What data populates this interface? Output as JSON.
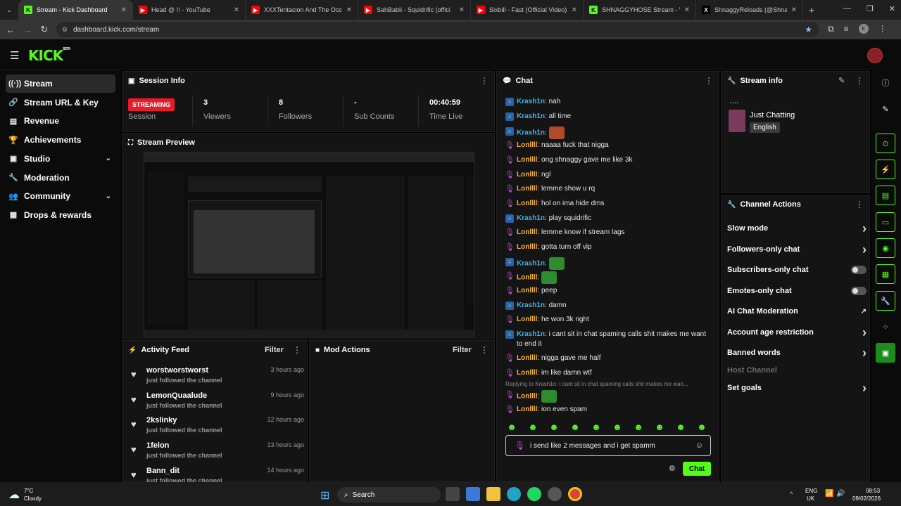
{
  "browser": {
    "tabs": [
      {
        "title": "Stream - Kick Dashboard",
        "color": "#53fc18",
        "letter": "K",
        "active": true
      },
      {
        "title": "Head @ !! - YouTube",
        "color": "#ff0000",
        "letter": "▶",
        "active": false
      },
      {
        "title": "XXXTentacion And The Occult",
        "color": "#ff0000",
        "letter": "▶",
        "active": false
      },
      {
        "title": "SahBabii - Squidrific (offici",
        "color": "#ff0000",
        "letter": "▶",
        "active": false
      },
      {
        "title": "Sixbill - Fast (Official Video) - Yo",
        "color": "#ff0000",
        "letter": "▶",
        "active": false
      },
      {
        "title": "SHNAGGYHOSE Stream - Watc",
        "color": "#53fc18",
        "letter": "K",
        "active": false
      },
      {
        "title": "ShnaggyReloads (@ShnaggyRe",
        "color": "#000000",
        "letter": "X",
        "active": false
      }
    ],
    "url": "dashboard.kick.com/stream",
    "new_tab": "+"
  },
  "brand": {
    "logo": "KICK",
    "beta": "BETA",
    "accent": "#53fc18"
  },
  "sidebar": {
    "items": [
      {
        "label": "Stream",
        "icon": "((·))",
        "active": true,
        "chev": ""
      },
      {
        "label": "Stream URL & Key",
        "icon": "🔗",
        "active": false,
        "chev": ""
      },
      {
        "label": "Revenue",
        "icon": "▤",
        "active": false,
        "chev": ""
      },
      {
        "label": "Achievements",
        "icon": "🏆",
        "active": false,
        "chev": ""
      },
      {
        "label": "Studio",
        "icon": "▣",
        "active": false,
        "chev": "⌄"
      },
      {
        "label": "Moderation",
        "icon": "🔧",
        "active": false,
        "chev": ""
      },
      {
        "label": "Community",
        "icon": "👥",
        "active": false,
        "chev": "⌄"
      },
      {
        "label": "Drops & rewards",
        "icon": "▦",
        "active": false,
        "chev": ""
      }
    ]
  },
  "session": {
    "title": "Session Info",
    "status_badge": "STREAMING",
    "status_label": "Session",
    "stats": [
      {
        "value": "3",
        "label": "Viewers"
      },
      {
        "value": "8",
        "label": "Followers"
      },
      {
        "value": "-",
        "label": "Sub Counts"
      },
      {
        "value": "00:40:59",
        "label": "Time Live"
      }
    ]
  },
  "preview": {
    "title": "Stream Preview"
  },
  "activity": {
    "title": "Activity Feed",
    "filter": "Filter",
    "items": [
      {
        "name": "worstworstworst",
        "sub": "just followed the channel",
        "time": "3 hours ago"
      },
      {
        "name": "LemonQuaalude",
        "sub": "just followed the channel",
        "time": "9 hours ago"
      },
      {
        "name": "2kslinky",
        "sub": "just followed the channel",
        "time": "12 hours ago"
      },
      {
        "name": "1felon",
        "sub": "just followed the channel",
        "time": "13 hours ago"
      },
      {
        "name": "Bann_dit",
        "sub": "just followed the channel",
        "time": "14 hours ago"
      }
    ]
  },
  "mod": {
    "title": "Mod Actions",
    "filter": "Filter"
  },
  "chat": {
    "title": "Chat",
    "messages": [
      {
        "user": "Krash1n",
        "kind": "krash",
        "text": ": nah"
      },
      {
        "user": "Krash1n",
        "kind": "krash",
        "text": ": all time"
      },
      {
        "user": "Krash1n",
        "kind": "krash",
        "text": ":",
        "emote": "#b04a2a"
      },
      {
        "user": "Lonllll",
        "kind": "lon",
        "text": ": naaaa fuck that nigga"
      },
      {
        "user": "Lonllll",
        "kind": "lon",
        "text": ": ong shnaggy gave me like 3k"
      },
      {
        "user": "Lonllll",
        "kind": "lon",
        "text": ": ngl"
      },
      {
        "user": "Lonllll",
        "kind": "lon",
        "text": ": lemme show u rq"
      },
      {
        "user": "Lonllll",
        "kind": "lon",
        "text": ": hol on ima hide dms"
      },
      {
        "user": "Krash1n",
        "kind": "krash",
        "text": ": play squidrific"
      },
      {
        "user": "Lonllll",
        "kind": "lon",
        "text": ": lemme know if stream lags"
      },
      {
        "user": "Lonllll",
        "kind": "lon",
        "text": ": gotta turn off vip"
      },
      {
        "user": "Krash1n",
        "kind": "krash",
        "text": ":",
        "emote": "#2e8b2e"
      },
      {
        "user": "Lonllll",
        "kind": "lon",
        "text": ":",
        "emote": "#2e8b2e"
      },
      {
        "user": "Lonllll",
        "kind": "lon",
        "text": ": peep"
      },
      {
        "user": "Krash1n",
        "kind": "krash",
        "text": ": damn"
      },
      {
        "user": "Lonllll",
        "kind": "lon",
        "text": ": he won 3k right"
      },
      {
        "user": "Krash1n",
        "kind": "krash",
        "text": ": i cant sit in chat spaming calls shit makes me want to end it"
      },
      {
        "user": "Lonllll",
        "kind": "lon",
        "text": ": nigga gave me half"
      },
      {
        "user": "Lonllll",
        "kind": "lon",
        "text": ": im like damn wtf"
      }
    ],
    "reply_hint": "Replying to Krash1n: i cant sit in chat spaming calls shit makes me wan...",
    "after_reply": [
      {
        "user": "Lonllll",
        "kind": "lon",
        "text": ":",
        "emote": "#2e8b2e"
      },
      {
        "user": "Lonllll",
        "kind": "lon",
        "text": ": ion even spam"
      }
    ],
    "input_value": "i send like 2 messages and i get spamm",
    "send_label": "Chat"
  },
  "stream_info": {
    "title": "Stream info",
    "stream_title": "....",
    "category": "Just Chatting",
    "language": "English"
  },
  "channel_actions": {
    "title": "Channel Actions",
    "items": [
      {
        "label": "Slow mode",
        "control": "chevron"
      },
      {
        "label": "Followers-only chat",
        "control": "chevron"
      },
      {
        "label": "Subscribers-only chat",
        "control": "toggle"
      },
      {
        "label": "Emotes-only chat",
        "control": "toggle"
      },
      {
        "label": "AI Chat Moderation",
        "control": "external"
      },
      {
        "label": "Account age restriction",
        "control": "chevron"
      },
      {
        "label": "Banned words",
        "control": "chevron"
      },
      {
        "label": "Host Channel",
        "control": "disabled"
      },
      {
        "label": "Set goals",
        "control": "chevron"
      }
    ]
  },
  "taskbar": {
    "weather_temp": "7°C",
    "weather_desc": "Cloudy",
    "search_label": "Search",
    "lang": "ENG",
    "region": "UK",
    "time": "08:53",
    "date": "09/02/2026"
  }
}
